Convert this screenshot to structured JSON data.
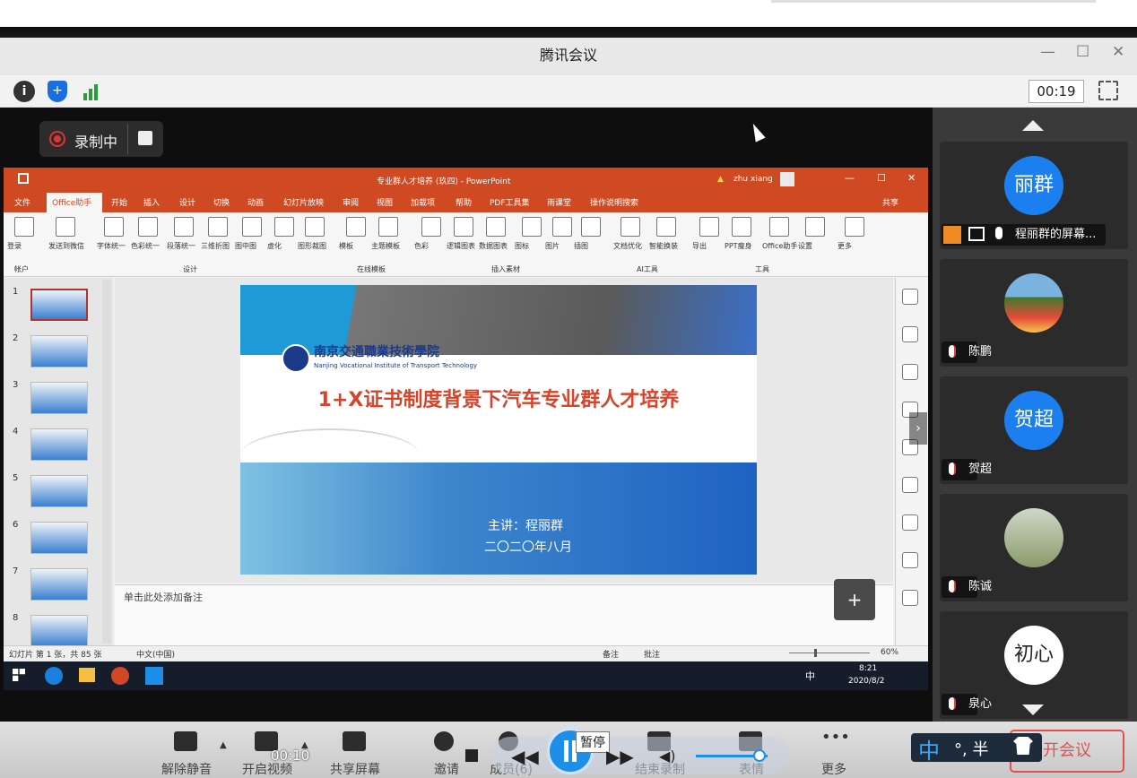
{
  "window": {
    "title": "腾讯会议",
    "elapsed": "00:19"
  },
  "recording": {
    "label": "录制中"
  },
  "ppt": {
    "doc_title": "专业群人才培养 (玖四)  -  PowerPoint",
    "user": "zhu xiang",
    "share_label": "共享",
    "tabs": [
      "文件",
      "Office助手",
      "开始",
      "插入",
      "设计",
      "切换",
      "动画",
      "幻灯片放映",
      "审阅",
      "视图",
      "加载项",
      "帮助",
      "PDF工具集",
      "雨课堂",
      "操作说明搜索"
    ],
    "ribbon_items": [
      "登录",
      "发送到微信",
      "字体统一",
      "色彩统一",
      "段落统一",
      "三维折图",
      "图中图",
      "虚化",
      "图形裁图",
      "模板",
      "主题模板",
      "色彩",
      "逻辑图表",
      "数据图表",
      "图标",
      "图片",
      "插图",
      "文档优化",
      "智能换装",
      "导出",
      "PPT瘦身",
      "Office助手",
      "设置",
      "更多"
    ],
    "ribbon_groups": [
      "帐户",
      "设计",
      "在线模板",
      "插入素材",
      "AI工具",
      "工具"
    ],
    "slide_numbers": [
      "1",
      "2",
      "3",
      "4",
      "5",
      "6",
      "7",
      "8"
    ],
    "slide": {
      "school_cn": "南京交通職業技術學院",
      "school_en": "Nanjing Vocational Institute of Transport Technology",
      "title": "1+X证书制度背景下汽车专业群人才培养",
      "speaker": "主讲：程丽群",
      "date": "二〇二〇年八月"
    },
    "notes_placeholder": "单击此处添加备注",
    "status_left": "幻灯片 第 1 张，共 85 张",
    "status_lang": "中文(中国)",
    "status_notes": "备注",
    "status_comments": "批注",
    "zoom": "60%",
    "taskbar_ime": "中",
    "taskbar_time": "8:21",
    "taskbar_date": "2020/8/2"
  },
  "participants": [
    {
      "avatar_text": "丽群",
      "name": "程丽群的屏幕..."
    },
    {
      "avatar_text": "",
      "name": "陈鹏"
    },
    {
      "avatar_text": "贺超",
      "name": "贺超"
    },
    {
      "avatar_text": "",
      "name": "陈诚"
    },
    {
      "avatar_text": "初心",
      "name": "泉心"
    }
  ],
  "toolbar": {
    "items": [
      "解除静音",
      "开启视频",
      "共享屏幕",
      "邀请",
      "成员(6)",
      "结束录制",
      "表情",
      "更多"
    ],
    "end_button": "开会议",
    "player_time": "00:10",
    "pause_tooltip": "暂停",
    "ime": "中",
    "ime_extra": "°, 半"
  },
  "colors": {
    "ppt_accent": "#cf4a22",
    "meeting_blue": "#1c7ff0",
    "record_red": "#dd3333",
    "end_red": "#e05050"
  }
}
